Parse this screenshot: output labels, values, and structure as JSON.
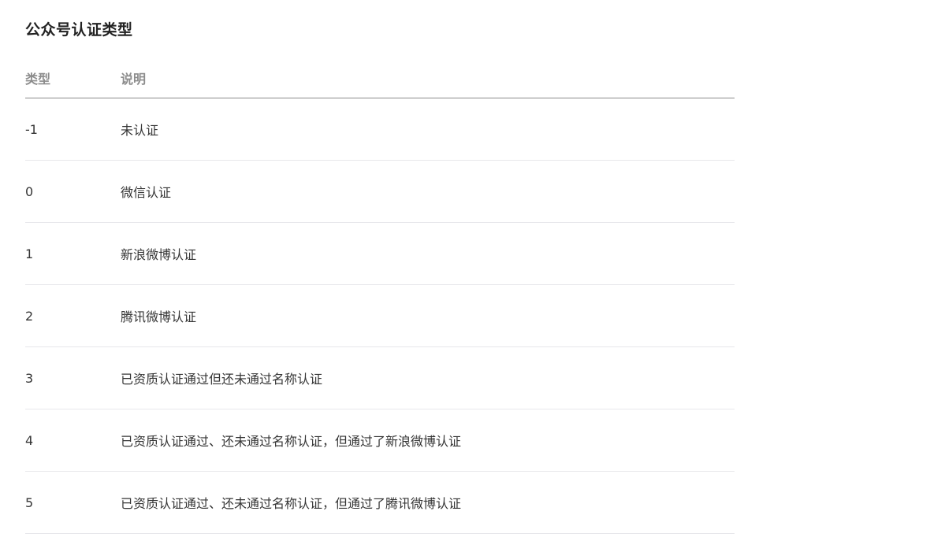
{
  "section": {
    "title": "公众号认证类型"
  },
  "table": {
    "headers": {
      "type": "类型",
      "description": "说明"
    },
    "rows": [
      {
        "type": "-1",
        "description": "未认证"
      },
      {
        "type": "0",
        "description": "微信认证"
      },
      {
        "type": "1",
        "description": "新浪微博认证"
      },
      {
        "type": "2",
        "description": "腾讯微博认证"
      },
      {
        "type": "3",
        "description": "已资质认证通过但还未通过名称认证"
      },
      {
        "type": "4",
        "description": "已资质认证通过、还未通过名称认证，但通过了新浪微博认证"
      },
      {
        "type": "5",
        "description": "已资质认证通过、还未通过名称认证，但通过了腾讯微博认证"
      }
    ]
  }
}
